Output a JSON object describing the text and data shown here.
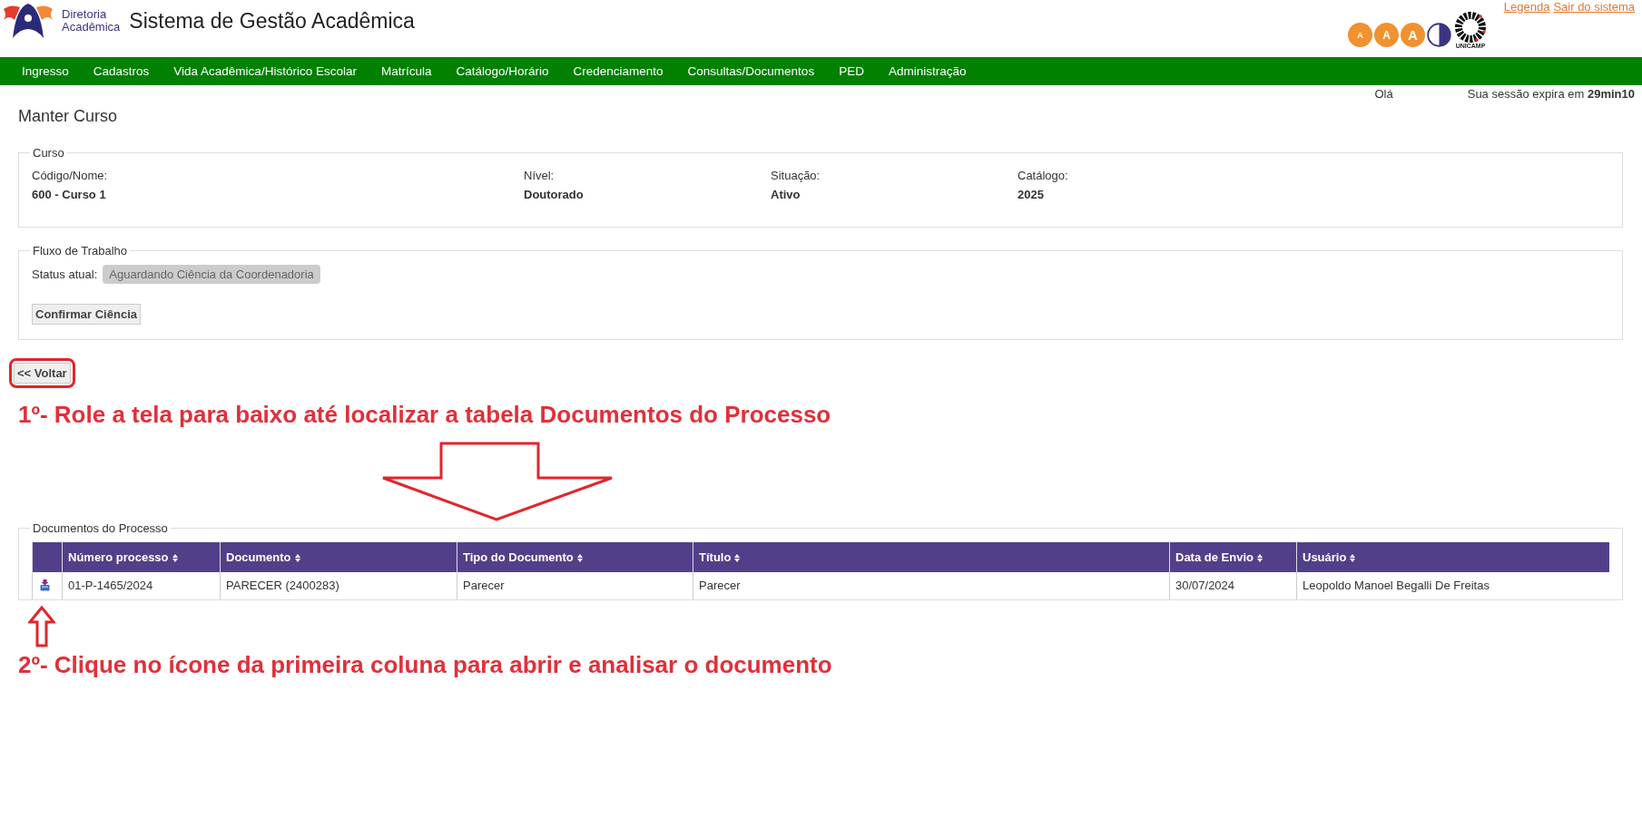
{
  "header": {
    "logo_lines": [
      "Diretoria",
      "Acadêmica"
    ],
    "title": "Sistema de Gestão Acadêmica",
    "links": [
      "Legenda",
      "Sair do sistema"
    ],
    "font_buttons": [
      "A",
      "A",
      "A"
    ],
    "university_label": "UNICAMP"
  },
  "nav": {
    "items": [
      "Ingresso",
      "Cadastros",
      "Vida Acadêmica/Histórico Escolar",
      "Matrícula",
      "Catálogo/Horário",
      "Credenciamento",
      "Consultas/Documentos",
      "PED",
      "Administração"
    ]
  },
  "session": {
    "greeting": "Olá",
    "expiry": "Sua sessão expira em **29min10**"
  },
  "page_title": "Manter Curso",
  "curso": {
    "legend": "Curso",
    "fields": [
      {
        "label": "Código/Nome:",
        "value": "600 - Curso 1"
      },
      {
        "label": "Nível:",
        "value": "Doutorado"
      },
      {
        "label": "Situação:",
        "value": "Ativo"
      },
      {
        "label": "Catálogo:",
        "value": "2025"
      }
    ]
  },
  "fluxo": {
    "legend": "Fluxo de Trabalho",
    "status_label": "Status atual:",
    "status": "Aguardando Ciência da Coordenadoria",
    "button": "Confirmar Ciência"
  },
  "back_button": "<< Voltar",
  "annotations": [
    "1º- Role a tela para baixo até localizar a tabela Documentos do Processo",
    "2º- Clique no ícone da primeira coluna para abrir e analisar o documento"
  ],
  "documentos": {
    "legend": "Documentos do Processo",
    "table": {
      "columns": [
        "Número processo",
        "Documento",
        "Tipo do Documento",
        "Título",
        "Data de Envio",
        "Usuário"
      ],
      "rows": [
        {
          "cells": [
            "01-P-1465/2024",
            "PARECER (2400283)",
            "Parecer",
            "Parecer",
            "30/07/2024",
            "Leopoldo Manoel Begalli De Freitas"
          ]
        }
      ]
    }
  }
}
